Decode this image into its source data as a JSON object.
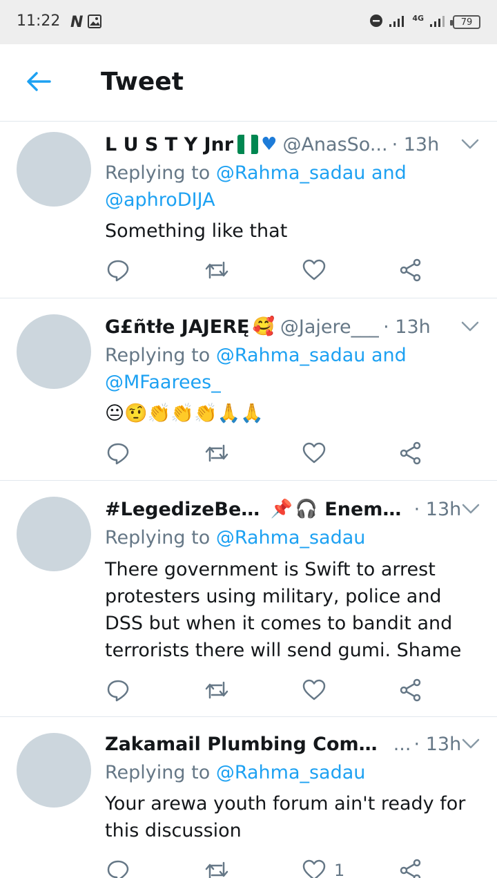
{
  "status_bar": {
    "time": "11:22",
    "network_label": "4G",
    "battery": "79"
  },
  "header": {
    "title": "Tweet"
  },
  "tweets": [
    {
      "name": "L U S T Y Jnr",
      "handle": "@AnasSo...",
      "time": "· 13h",
      "replying_prefix": "Replying to",
      "mention_1": "@Rahma_sadau",
      "and": " and",
      "mention_2": "@aphroDIJA",
      "text": "Something like that"
    },
    {
      "name": "G£ñtłe JAJERĘ",
      "handle": "@Jajere___",
      "time": "· 13h",
      "replying_prefix": "Replying to",
      "mention_1": "@Rahma_sadau",
      "and": " and",
      "mention_2": "@MFaarees_",
      "text": "😐🤨👏👏👏🙏🙏"
    },
    {
      "name": "#LegedizeBenz#",
      "name_2": "Enemo...",
      "time": "· 13h",
      "replying_prefix": "Replying to",
      "mention_1": "@Rahma_sadau",
      "text": "There government is Swift to arrest protesters using military, police and DSS but when it comes to bandit and terrorists there will send gumi. Shame"
    },
    {
      "name": "Zakamail Plumbing Company",
      "handle": "...",
      "time": "· 13h",
      "replying_prefix": "Replying to",
      "mention_1": "@Rahma_sadau",
      "text": "Your arewa youth forum ain't ready for this discussion",
      "like_count": "1"
    }
  ],
  "colors": {
    "accent": "#1da1f2",
    "secondary_text": "#657786",
    "avatar_placeholder": "#ccd6dd",
    "divider": "#e1e8ed"
  }
}
